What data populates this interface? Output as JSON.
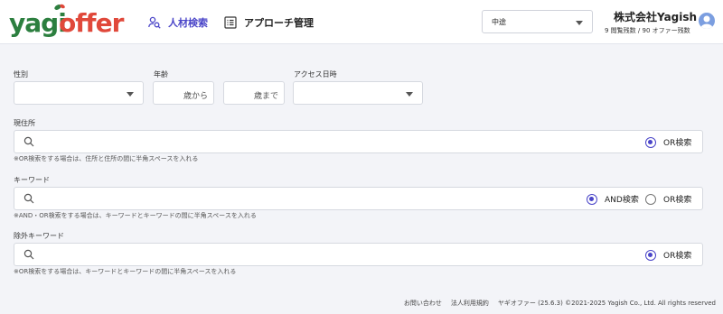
{
  "header": {
    "logo_part1": "yagi",
    "logo_part2": "offer",
    "nav": [
      {
        "label": "人材検索",
        "icon": "person-search-icon",
        "active": true
      },
      {
        "label": "アプローチ管理",
        "icon": "list-icon",
        "active": false
      }
    ],
    "type_select_value": "中途",
    "company_name": "株式会社Yagish",
    "stats": "9 閲覧残数 / 90 オファー残数"
  },
  "form": {
    "gender": {
      "label": "性別",
      "value": ""
    },
    "age": {
      "label": "年齢",
      "from_suffix": "歳から",
      "to_suffix": "歳まで"
    },
    "access": {
      "label": "アクセス日時",
      "value": ""
    },
    "residence": {
      "label": "現住所",
      "value": "",
      "options": [
        {
          "label": "OR検索",
          "selected": true
        }
      ],
      "hint": "※OR検索をする場合は、住所と住所の間に半角スペースを入れる"
    },
    "keyword": {
      "label": "キーワード",
      "value": "",
      "options": [
        {
          "label": "AND検索",
          "selected": true
        },
        {
          "label": "OR検索",
          "selected": false
        }
      ],
      "hint": "※AND・OR検索をする場合は、キーワードとキーワードの間に半角スペースを入れる"
    },
    "exclude": {
      "label": "除外キーワード",
      "value": "",
      "options": [
        {
          "label": "OR検索",
          "selected": true
        }
      ],
      "hint": "※OR検索をする場合は、キーワードとキーワードの間に半角スペースを入れる"
    }
  },
  "footer": {
    "contact": "お問い合わせ",
    "terms": "法人利用規約",
    "copyright": "ヤギオファー (25.6.3) ©2021-2025 Yagish Co., Ltd. All rights reserved"
  },
  "colors": {
    "accent": "#4a45c8",
    "logo_green": "#2c7f3f",
    "logo_red": "#e0483a",
    "background": "#f3f4f8"
  }
}
